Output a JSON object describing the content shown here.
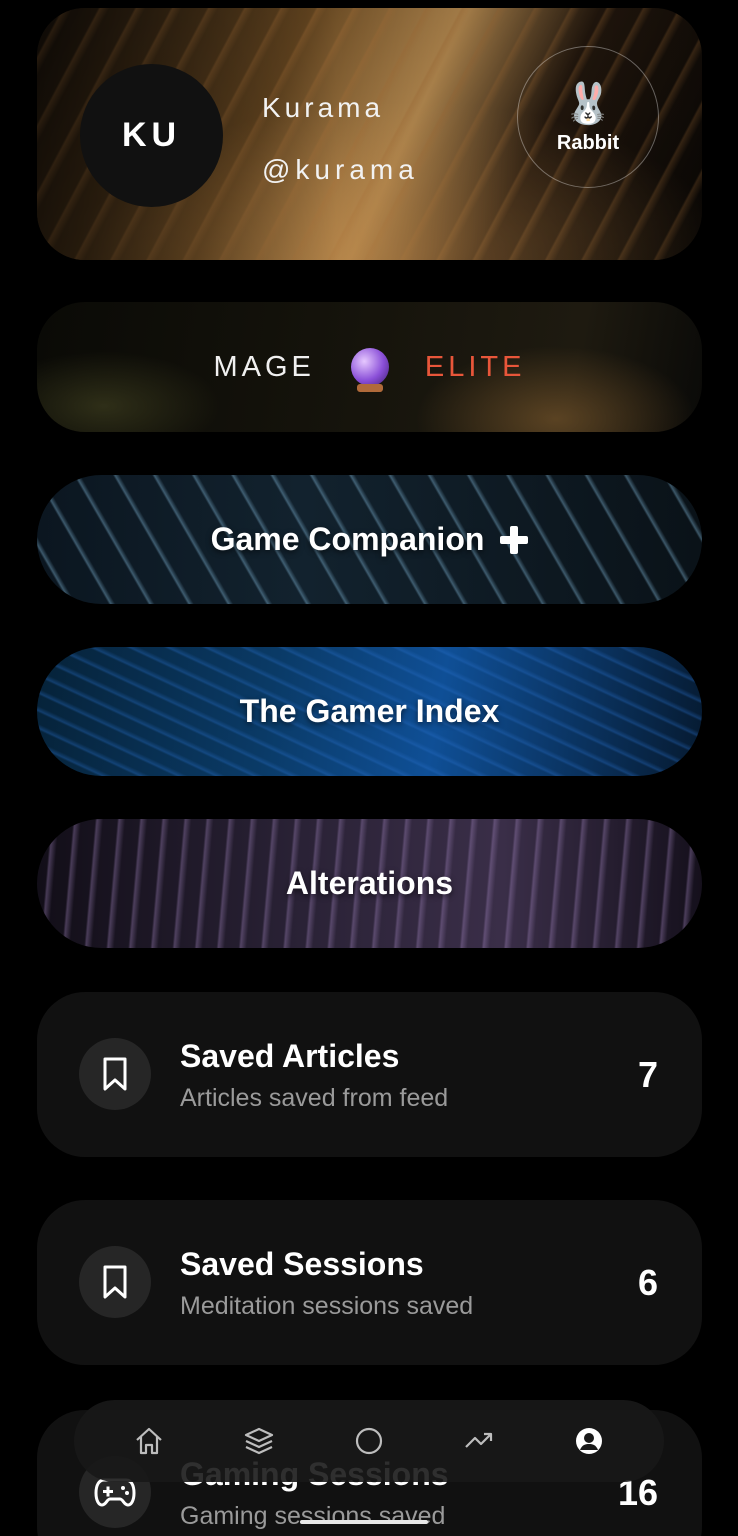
{
  "profile": {
    "initials": "KU",
    "display_name": "Kurama",
    "handle": "@kurama",
    "spirit_animal": {
      "icon": "rabbit-emoji",
      "glyph": "🐰",
      "label": "Rabbit"
    }
  },
  "rank": {
    "class": "MAGE",
    "icon": "crystal-ball-icon",
    "tier": "ELITE",
    "tier_color": "#e8563a"
  },
  "features": [
    {
      "label": "Game Companion",
      "icon": "plus-icon"
    },
    {
      "label": "The Gamer Index"
    },
    {
      "label": "Alterations"
    }
  ],
  "lists": [
    {
      "icon": "bookmark-icon",
      "title": "Saved Articles",
      "subtitle": "Articles saved from feed",
      "count": "7"
    },
    {
      "icon": "bookmark-icon",
      "title": "Saved Sessions",
      "subtitle": "Meditation sessions saved",
      "count": "6"
    },
    {
      "icon": "gamepad-icon",
      "title": "Gaming Sessions",
      "subtitle": "Gaming sessions saved",
      "count": "16"
    }
  ],
  "nav": {
    "items": [
      "home-icon",
      "layers-icon",
      "circle-icon",
      "trending-icon",
      "profile-icon"
    ],
    "active": "profile-icon"
  }
}
